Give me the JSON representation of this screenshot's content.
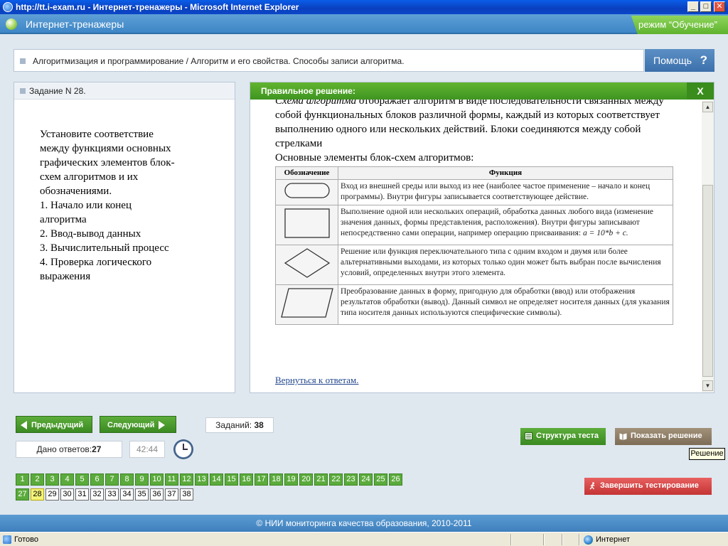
{
  "window": {
    "title": "http://tt.i-exam.ru - Интернет-тренажеры - Microsoft Internet Explorer",
    "min": "_",
    "max": "□",
    "close": "✕"
  },
  "app": {
    "title": "Интернет-тренажеры",
    "mode": "режим “Обучение”"
  },
  "breadcrumb": "Алгоритмизация и программирование / Алгоритм и его свойства. Способы записи алгоритма.",
  "help_label": "Помощь",
  "help_icon": "?",
  "task": {
    "header": "Задание N 28.",
    "lines": [
      "Установите соответствие",
      "между функциями основных",
      "графических элементов блок-",
      "схем алгоритмов и их",
      "обозначениями.",
      "1. Начало или конец",
      "алгоритма",
      "2. Ввод-вывод данных",
      "3. Вычислительный процесс",
      "4. Проверка логического",
      "выражения"
    ]
  },
  "solution": {
    "header": "Правильное решение:",
    "close": "X",
    "intro_italic": "Схема алгоритма",
    "intro_rest": " отображает алгоритм в виде последовательности связанных между собой функциональных блоков различной формы, каждый из которых соответствует выполнению одного или нескольких действий. Блоки соединяются между собой стрелками",
    "subtitle": "Основные элементы блок-схем алгоритмов:",
    "table_headers": [
      "Обозначение",
      "Функция"
    ],
    "rows": [
      {
        "shape": "terminator",
        "text": "Вход из внешней среды или выход из нее (наиболее частое применение – начало и конец программы). Внутри фигуры записывается соответствующее действие."
      },
      {
        "shape": "process",
        "text": "Выполнение одной или нескольких операций, обработка данных любого вида (изменение значения данных, формы представления, расположения). Внутри фигуры записывают непосредственно сами операции, например операцию присваивания: ",
        "formula": "a = 10*b + c."
      },
      {
        "shape": "decision",
        "text": "Решение или функция переключательного типа с одним входом и двумя или более альтернативными выходами, из которых только один может быть выбран после вычисления условий, определенных внутри этого элемента."
      },
      {
        "shape": "data",
        "text": "Преобразование данных в форму, пригодную для обработки (ввод) или отображения результатов обработки (вывод). Данный символ не определяет носителя данных (для указания типа носителя данных используются специфические символы)."
      }
    ],
    "back_link": "Вернуться к ответам."
  },
  "toolbar": {
    "prev": "Предыдущий",
    "next": "Следующий",
    "tasks_label": "Заданий: ",
    "tasks_count": "38",
    "answered_label": "Дано ответов:",
    "answered_count": "27",
    "timer": "42:44",
    "structure": "Структура теста",
    "show_solution": "Показать решение",
    "tooltip": "Решение",
    "finish": "Завершить тестирование"
  },
  "questions": {
    "numbers": [
      "1",
      "2",
      "3",
      "4",
      "5",
      "6",
      "7",
      "8",
      "9",
      "10",
      "11",
      "12",
      "13",
      "14",
      "15",
      "16",
      "17",
      "18",
      "19",
      "20",
      "21",
      "22",
      "23",
      "24",
      "25",
      "26",
      "27",
      "28",
      "29",
      "30",
      "31",
      "32",
      "33",
      "34",
      "35",
      "36",
      "37",
      "38"
    ],
    "answered_through": 27,
    "current": 28
  },
  "footer": "© НИИ мониторинга качества образования, 2010-2011",
  "status": {
    "left": "Готово",
    "zone": "Интернет"
  },
  "colors": {
    "accent_green": "#4ea02c",
    "header_blue": "#3d86c6",
    "finish_red": "#d94242",
    "current_yellow": "#f3f37a"
  }
}
